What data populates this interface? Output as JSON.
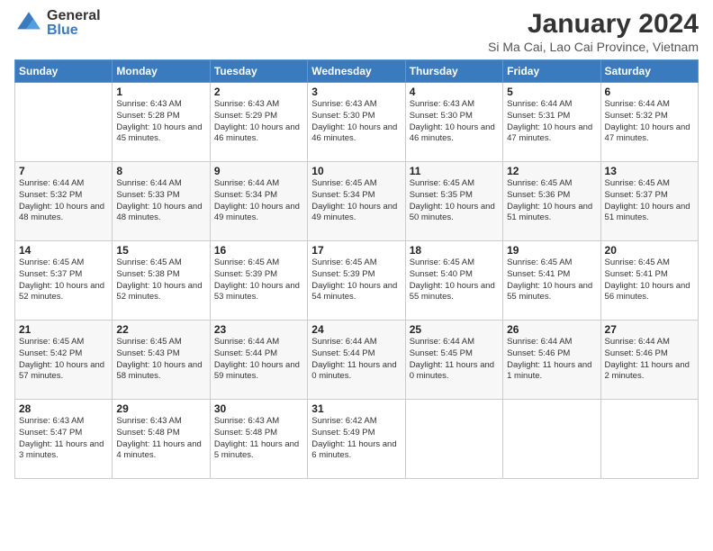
{
  "logo": {
    "general": "General",
    "blue": "Blue"
  },
  "title": "January 2024",
  "location": "Si Ma Cai, Lao Cai Province, Vietnam",
  "headers": [
    "Sunday",
    "Monday",
    "Tuesday",
    "Wednesday",
    "Thursday",
    "Friday",
    "Saturday"
  ],
  "weeks": [
    [
      null,
      {
        "day": "1",
        "sunrise": "Sunrise: 6:43 AM",
        "sunset": "Sunset: 5:28 PM",
        "daylight": "Daylight: 10 hours and 45 minutes."
      },
      {
        "day": "2",
        "sunrise": "Sunrise: 6:43 AM",
        "sunset": "Sunset: 5:29 PM",
        "daylight": "Daylight: 10 hours and 46 minutes."
      },
      {
        "day": "3",
        "sunrise": "Sunrise: 6:43 AM",
        "sunset": "Sunset: 5:30 PM",
        "daylight": "Daylight: 10 hours and 46 minutes."
      },
      {
        "day": "4",
        "sunrise": "Sunrise: 6:43 AM",
        "sunset": "Sunset: 5:30 PM",
        "daylight": "Daylight: 10 hours and 46 minutes."
      },
      {
        "day": "5",
        "sunrise": "Sunrise: 6:44 AM",
        "sunset": "Sunset: 5:31 PM",
        "daylight": "Daylight: 10 hours and 47 minutes."
      },
      {
        "day": "6",
        "sunrise": "Sunrise: 6:44 AM",
        "sunset": "Sunset: 5:32 PM",
        "daylight": "Daylight: 10 hours and 47 minutes."
      }
    ],
    [
      {
        "day": "7",
        "sunrise": "Sunrise: 6:44 AM",
        "sunset": "Sunset: 5:32 PM",
        "daylight": "Daylight: 10 hours and 48 minutes."
      },
      {
        "day": "8",
        "sunrise": "Sunrise: 6:44 AM",
        "sunset": "Sunset: 5:33 PM",
        "daylight": "Daylight: 10 hours and 48 minutes."
      },
      {
        "day": "9",
        "sunrise": "Sunrise: 6:44 AM",
        "sunset": "Sunset: 5:34 PM",
        "daylight": "Daylight: 10 hours and 49 minutes."
      },
      {
        "day": "10",
        "sunrise": "Sunrise: 6:45 AM",
        "sunset": "Sunset: 5:34 PM",
        "daylight": "Daylight: 10 hours and 49 minutes."
      },
      {
        "day": "11",
        "sunrise": "Sunrise: 6:45 AM",
        "sunset": "Sunset: 5:35 PM",
        "daylight": "Daylight: 10 hours and 50 minutes."
      },
      {
        "day": "12",
        "sunrise": "Sunrise: 6:45 AM",
        "sunset": "Sunset: 5:36 PM",
        "daylight": "Daylight: 10 hours and 51 minutes."
      },
      {
        "day": "13",
        "sunrise": "Sunrise: 6:45 AM",
        "sunset": "Sunset: 5:37 PM",
        "daylight": "Daylight: 10 hours and 51 minutes."
      }
    ],
    [
      {
        "day": "14",
        "sunrise": "Sunrise: 6:45 AM",
        "sunset": "Sunset: 5:37 PM",
        "daylight": "Daylight: 10 hours and 52 minutes."
      },
      {
        "day": "15",
        "sunrise": "Sunrise: 6:45 AM",
        "sunset": "Sunset: 5:38 PM",
        "daylight": "Daylight: 10 hours and 52 minutes."
      },
      {
        "day": "16",
        "sunrise": "Sunrise: 6:45 AM",
        "sunset": "Sunset: 5:39 PM",
        "daylight": "Daylight: 10 hours and 53 minutes."
      },
      {
        "day": "17",
        "sunrise": "Sunrise: 6:45 AM",
        "sunset": "Sunset: 5:39 PM",
        "daylight": "Daylight: 10 hours and 54 minutes."
      },
      {
        "day": "18",
        "sunrise": "Sunrise: 6:45 AM",
        "sunset": "Sunset: 5:40 PM",
        "daylight": "Daylight: 10 hours and 55 minutes."
      },
      {
        "day": "19",
        "sunrise": "Sunrise: 6:45 AM",
        "sunset": "Sunset: 5:41 PM",
        "daylight": "Daylight: 10 hours and 55 minutes."
      },
      {
        "day": "20",
        "sunrise": "Sunrise: 6:45 AM",
        "sunset": "Sunset: 5:41 PM",
        "daylight": "Daylight: 10 hours and 56 minutes."
      }
    ],
    [
      {
        "day": "21",
        "sunrise": "Sunrise: 6:45 AM",
        "sunset": "Sunset: 5:42 PM",
        "daylight": "Daylight: 10 hours and 57 minutes."
      },
      {
        "day": "22",
        "sunrise": "Sunrise: 6:45 AM",
        "sunset": "Sunset: 5:43 PM",
        "daylight": "Daylight: 10 hours and 58 minutes."
      },
      {
        "day": "23",
        "sunrise": "Sunrise: 6:44 AM",
        "sunset": "Sunset: 5:44 PM",
        "daylight": "Daylight: 10 hours and 59 minutes."
      },
      {
        "day": "24",
        "sunrise": "Sunrise: 6:44 AM",
        "sunset": "Sunset: 5:44 PM",
        "daylight": "Daylight: 11 hours and 0 minutes."
      },
      {
        "day": "25",
        "sunrise": "Sunrise: 6:44 AM",
        "sunset": "Sunset: 5:45 PM",
        "daylight": "Daylight: 11 hours and 0 minutes."
      },
      {
        "day": "26",
        "sunrise": "Sunrise: 6:44 AM",
        "sunset": "Sunset: 5:46 PM",
        "daylight": "Daylight: 11 hours and 1 minute."
      },
      {
        "day": "27",
        "sunrise": "Sunrise: 6:44 AM",
        "sunset": "Sunset: 5:46 PM",
        "daylight": "Daylight: 11 hours and 2 minutes."
      }
    ],
    [
      {
        "day": "28",
        "sunrise": "Sunrise: 6:43 AM",
        "sunset": "Sunset: 5:47 PM",
        "daylight": "Daylight: 11 hours and 3 minutes."
      },
      {
        "day": "29",
        "sunrise": "Sunrise: 6:43 AM",
        "sunset": "Sunset: 5:48 PM",
        "daylight": "Daylight: 11 hours and 4 minutes."
      },
      {
        "day": "30",
        "sunrise": "Sunrise: 6:43 AM",
        "sunset": "Sunset: 5:48 PM",
        "daylight": "Daylight: 11 hours and 5 minutes."
      },
      {
        "day": "31",
        "sunrise": "Sunrise: 6:42 AM",
        "sunset": "Sunset: 5:49 PM",
        "daylight": "Daylight: 11 hours and 6 minutes."
      },
      null,
      null,
      null
    ]
  ]
}
